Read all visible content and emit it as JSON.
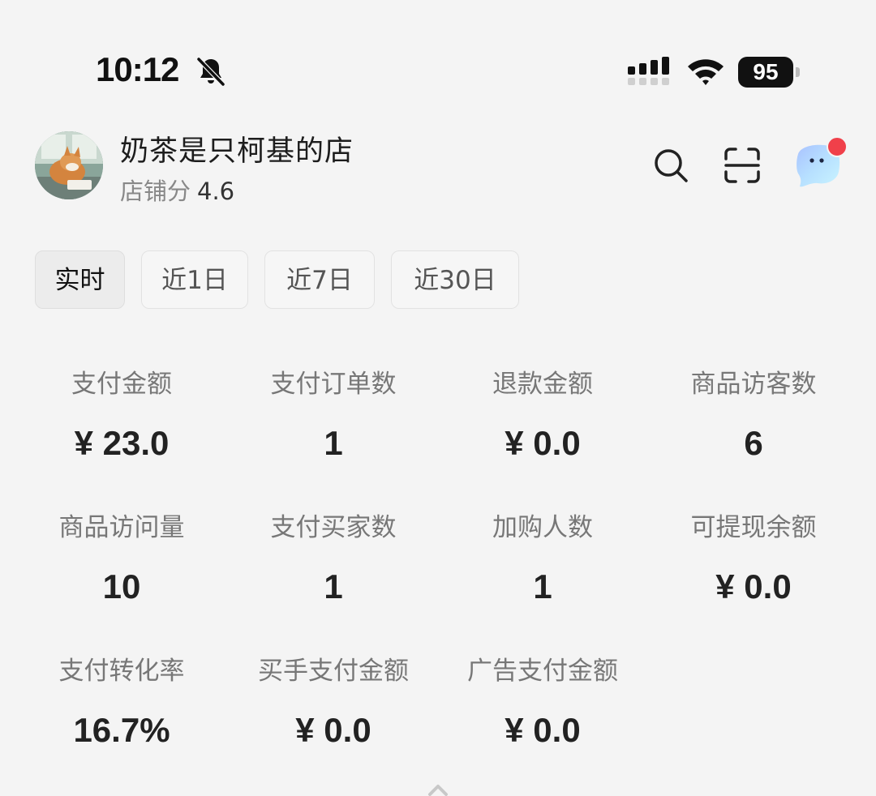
{
  "status_bar": {
    "time": "10:12",
    "battery": "95"
  },
  "shop": {
    "name": "奶茶是只柯基的店",
    "score_label": "店铺分",
    "score_value": "4.6"
  },
  "tabs": [
    {
      "label": "实时",
      "active": true
    },
    {
      "label": "近1日",
      "active": false
    },
    {
      "label": "近7日",
      "active": false
    },
    {
      "label": "近30日",
      "active": false
    }
  ],
  "metrics": [
    {
      "label": "支付金额",
      "value": "¥ 23.0"
    },
    {
      "label": "支付订单数",
      "value": "1"
    },
    {
      "label": "退款金额",
      "value": "¥ 0.0"
    },
    {
      "label": "商品访客数",
      "value": "6"
    },
    {
      "label": "商品访问量",
      "value": "10"
    },
    {
      "label": "支付买家数",
      "value": "1"
    },
    {
      "label": "加购人数",
      "value": "1"
    },
    {
      "label": "可提现余额",
      "value": "¥ 0.0"
    },
    {
      "label": "支付转化率",
      "value": "16.7%"
    },
    {
      "label": "买手支付金额",
      "value": "¥ 0.0"
    },
    {
      "label": "广告支付金额",
      "value": "¥ 0.0"
    }
  ],
  "icons": {
    "bell": "bell-slash-icon",
    "signal": "cellular-signal-icon",
    "wifi": "wifi-icon",
    "search": "search-icon",
    "scan": "scan-icon",
    "assistant": "ai-assistant-icon"
  },
  "colors": {
    "badge": "#f0404a",
    "background": "#f4f4f4"
  }
}
